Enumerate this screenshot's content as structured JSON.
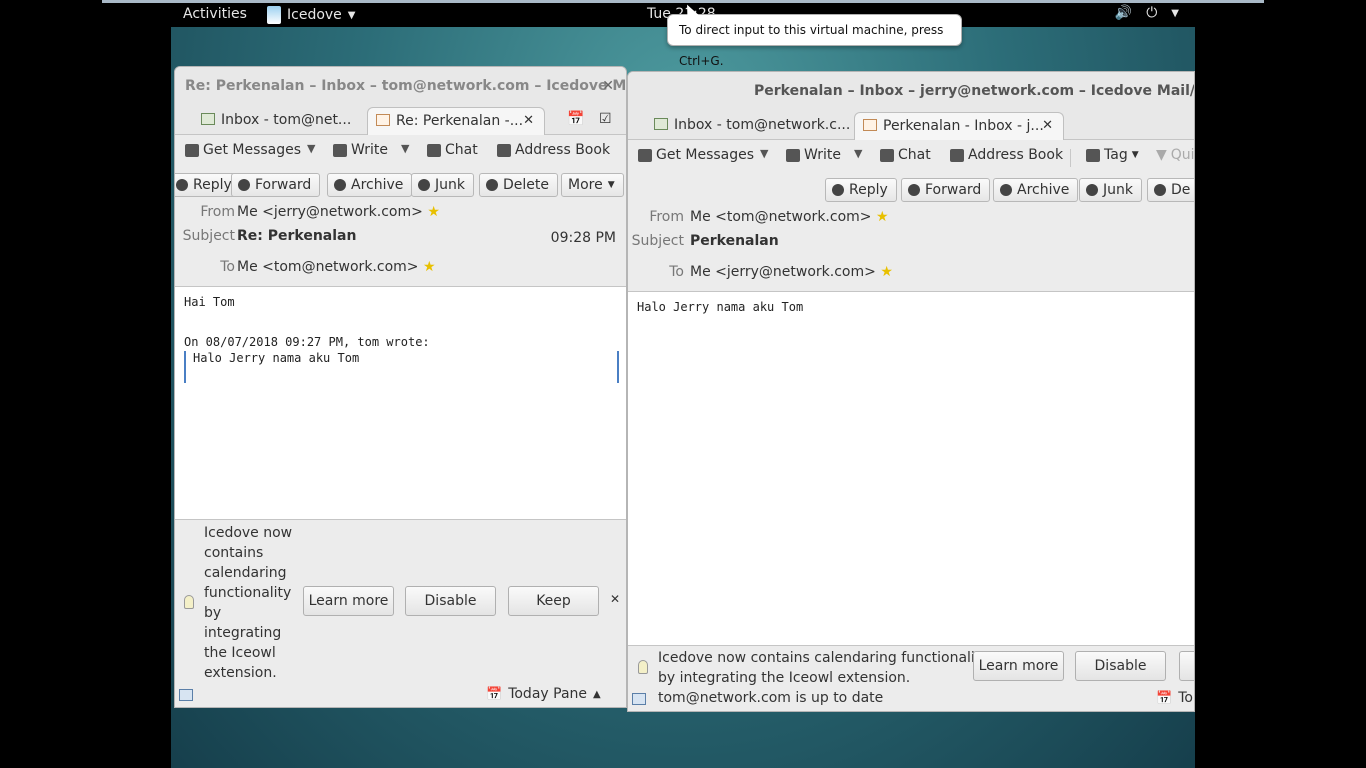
{
  "topbar": {
    "activities": "Activities",
    "app_name": "Icedove",
    "clock": "Tue 21:28"
  },
  "tooltip": "To direct input to this virtual machine, press Ctrl+G.",
  "window_left": {
    "title": "Re: Perkenalan – Inbox – tom@network.com – Icedove M...",
    "tabs": [
      "Inbox - tom@net...",
      "Re: Perkenalan -..."
    ],
    "toolbar": {
      "get_messages": "Get Messages",
      "write": "Write",
      "chat": "Chat",
      "address_book": "Address Book"
    },
    "actions": {
      "reply": "Reply",
      "forward": "Forward",
      "archive": "Archive",
      "junk": "Junk",
      "delete": "Delete",
      "more": "More"
    },
    "header": {
      "from_label": "From",
      "from": "Me <jerry@network.com>",
      "subject_label": "Subject",
      "subject": "Re: Perkenalan",
      "time": "09:28 PM",
      "to_label": "To",
      "to": "Me <tom@network.com>"
    },
    "body": {
      "line1": "Hai Tom",
      "attribution": "On 08/07/2018 09:27 PM, tom wrote:",
      "quote": "Halo Jerry nama aku Tom"
    },
    "notification": {
      "lines": [
        "Icedove now",
        "contains",
        "calendaring",
        "functionality",
        "by",
        "integrating",
        "the Iceowl",
        "extension."
      ],
      "learn_more": "Learn more",
      "disable": "Disable",
      "keep": "Keep"
    },
    "status": {
      "today_pane": "Today Pane"
    }
  },
  "window_right": {
    "title": "Perkenalan – Inbox – jerry@network.com – Icedove Mail/News",
    "tabs": [
      "Inbox - tom@network.c...",
      "Perkenalan - Inbox - j..."
    ],
    "toolbar": {
      "get_messages": "Get Messages",
      "write": "Write",
      "chat": "Chat",
      "address_book": "Address Book",
      "tag": "Tag",
      "quick_filter": "Qui"
    },
    "actions": {
      "reply": "Reply",
      "forward": "Forward",
      "archive": "Archive",
      "junk": "Junk",
      "delete": "De"
    },
    "header": {
      "from_label": "From",
      "from": "Me <tom@network.com>",
      "subject_label": "Subject",
      "subject": "Perkenalan",
      "to_label": "To",
      "to": "Me <jerry@network.com>"
    },
    "body": {
      "line1": "Halo Jerry nama aku Tom"
    },
    "notification": {
      "line1": "Icedove now contains calendaring functionality",
      "line2": "by integrating the Iceowl extension.",
      "learn_more": "Learn more",
      "disable": "Disable"
    },
    "status": {
      "text": "tom@network.com is up to date",
      "today_pane": "To"
    }
  }
}
